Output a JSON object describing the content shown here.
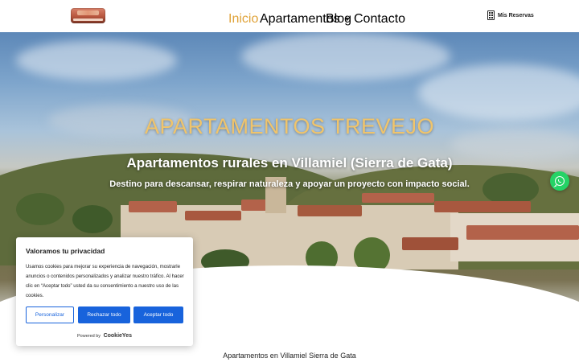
{
  "header": {
    "nav": [
      {
        "label": "Inicio",
        "active": true
      },
      {
        "label": "Apartamentos",
        "has_dropdown": true
      },
      {
        "label": "Blog"
      },
      {
        "label": "Contacto"
      }
    ],
    "reservas_label": "Mis Reservas",
    "reservas_icon": "building-icon",
    "logo_icon": "logo"
  },
  "hero": {
    "title": "APARTAMENTOS TREVEJO",
    "subtitle": "Apartamentos rurales en Villamiel (Sierra de Gata)",
    "tagline": "Destino para descansar, respirar naturaleza y apoyar un proyecto con impacto social.",
    "title_color": "#f0c46b"
  },
  "whatsapp": {
    "icon": "whatsapp-icon",
    "color": "#25d366"
  },
  "cookie_banner": {
    "title": "Valoramos tu privacidad",
    "text": "Usamos cookies para mejorar su experiencia de navegación, mostrarle anuncios o contenidos personalizados y analizar nuestro tráfico. Al hacer clic en “Aceptar todo” usted da su consentimiento a nuestro uso de las cookies.",
    "buttons": {
      "customize": "Personalizar",
      "reject": "Rechazar todo",
      "accept": "Aceptar todo"
    },
    "powered_by": "Powered by",
    "brand": "CookieYes",
    "accent_color": "#1863dc"
  },
  "section": {
    "title": "Apartamentos en Villamiel Sierra de Gata"
  }
}
